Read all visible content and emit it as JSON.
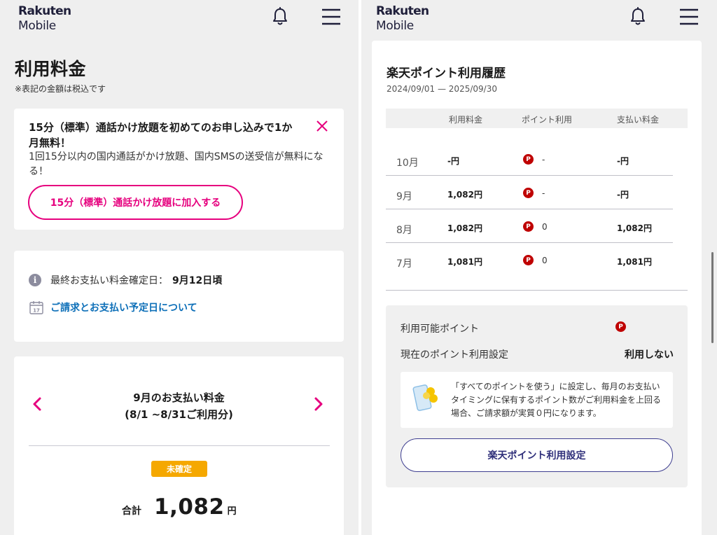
{
  "left_panel": {
    "logo": {
      "line1": "Rakuten",
      "line2": "Mobile"
    },
    "page_title": "利用料金",
    "tax_note": "※表記の金額は税込です",
    "promo": {
      "title": "15分（標準）通話かけ放題を初めてのお申し込みで1か月無料！",
      "description": "1回15分以内の国内通話がかけ放題、国内SMSの送受信が無料になる！",
      "button_label": "15分（標準）通話かけ放題に加入する"
    },
    "info": {
      "icon_glyph": "i",
      "confirm_label": "最終お支払い料金確定日：",
      "confirm_date": "9月12日頃",
      "link_label": "ご請求とお支払い予定日について",
      "calendar_day": "17"
    },
    "bill": {
      "title": "9月のお支払い料金",
      "period": "(8/1 ~8/31ご利用分)",
      "status_badge": "未確定",
      "total_label": "合計",
      "total_value": "1,082",
      "total_unit": "円"
    }
  },
  "right_panel": {
    "logo": {
      "line1": "Rakuten",
      "line2": "Mobile"
    },
    "title": "楽天ポイント利用履歴",
    "date_range": "2024/09/01 — 2025/09/30",
    "table": {
      "headers": [
        "利用料金",
        "ポイント利用",
        "支払い料金"
      ],
      "rows": [
        {
          "month": "10月",
          "fee": "-円",
          "points": "-",
          "payment": "-円"
        },
        {
          "month": "9月",
          "fee": "1,082円",
          "points": "-",
          "payment": "-円"
        },
        {
          "month": "8月",
          "fee": "1,082円",
          "points": "0",
          "payment": "1,082円"
        },
        {
          "month": "7月",
          "fee": "1,081円",
          "points": "0",
          "payment": "1,081円"
        }
      ]
    },
    "points_box": {
      "available_label": "利用可能ポイント",
      "setting_label": "現在のポイント利用設定",
      "setting_value": "利用しない",
      "note": "「すべてのポイントを使う」に設定し、毎月のお支払いタイミングに保有するポイント数がご利用料金を上回る場合、ご請求額が実質０円になります。",
      "button_label": "楽天ポイント利用設定"
    },
    "point_icon_glyph": "P"
  },
  "colors": {
    "accent_pink": "#e6007e",
    "link_blue": "#0d6fb8",
    "badge_orange": "#f5a800",
    "point_red": "#bf0000",
    "navy": "#2f2f7a"
  }
}
